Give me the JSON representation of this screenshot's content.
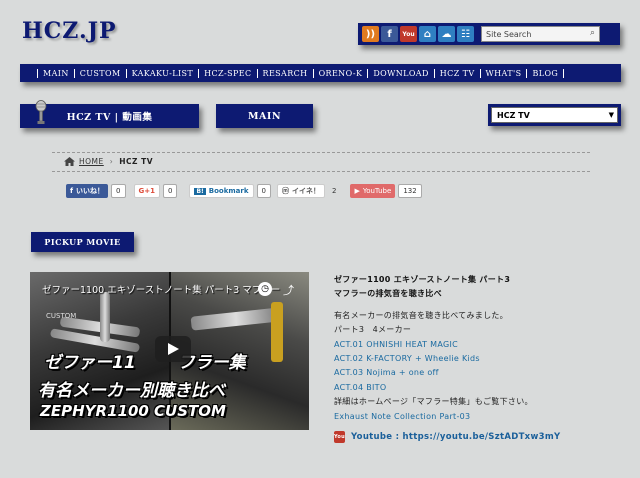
{
  "site": {
    "logo": "HCZ.JP"
  },
  "header": {
    "icons": [
      {
        "name": "rss-icon",
        "glyph": "))",
        "color": "#e07a1f"
      },
      {
        "name": "facebook-icon",
        "glyph": "f",
        "color": "#3b5998"
      },
      {
        "name": "youtube-icon",
        "glyph": "You",
        "color": "#c0392b"
      },
      {
        "name": "home-icon",
        "glyph": "⌂",
        "color": "#2f7fc1"
      },
      {
        "name": "chat-icon",
        "glyph": "☁",
        "color": "#2f7fc1"
      },
      {
        "name": "sitemap-icon",
        "glyph": "☷",
        "color": "#2f7fc1"
      }
    ],
    "search_placeholder": "Site Search"
  },
  "menu": [
    "MAIN",
    "CUSTOM",
    "KAKAKU-LIST",
    "HCZ-SPEC",
    "RESARCH",
    "ORENO-K",
    "DOWNLOAD",
    "HCZ TV",
    "WHAT'S",
    "BLOG"
  ],
  "buttons": {
    "hcztv": "HCZ TV | 動画集",
    "main": "MAIN"
  },
  "select": {
    "value": "HCZ TV"
  },
  "breadcrumb": {
    "home": "HOME",
    "current": "HCZ TV"
  },
  "social": {
    "like_label": "いいね！",
    "like_count": "0",
    "gplus_label": "G+1",
    "gplus_count": "0",
    "hatena_label": "Bookmark",
    "hatena_count": "0",
    "mixi_label": "イイネ！",
    "mixi_count": "2",
    "youtube_label": "YouTube",
    "youtube_count": "132"
  },
  "pickup": {
    "label": "PICKUP MOVIE"
  },
  "video": {
    "title": "ゼファー1100 エキゾーストノート集 パート3 マフラー",
    "custom_tag": "CUSTOM",
    "overlay1": "ゼファー11",
    "overlay1b": "フラー集",
    "overlay2": "有名メーカー別聴き比べ",
    "overlay3": "ZEPHYR1100 CUSTOM"
  },
  "description": {
    "title1": "ゼファー1100 エキゾーストノート集 パート3",
    "title2": "マフラーの排気音を聴き比べ",
    "intro": "有名メーカーの排気音を聴き比べてみました。",
    "part": "パート3　4メーカー",
    "act1": "ACT.01 OHNISHI HEAT MAGIC",
    "act2": "ACT.02 K-FACTORY + Wheelie Kids",
    "act3": "ACT.03 Nojima + one off",
    "act4": "ACT.04 BITO",
    "detail": "詳細はホームページ「マフラー特集」もご覧下さい。",
    "collection": "Exhaust Note Collection Part-03",
    "youtube": "Youtube : https://youtu.be/SztADTxw3mY"
  }
}
